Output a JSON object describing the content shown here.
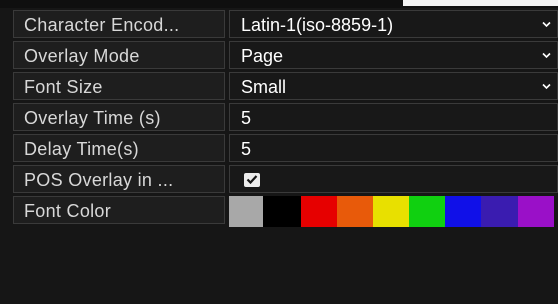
{
  "settings": {
    "rows": [
      {
        "label": "Character Encod...",
        "value": "Latin-1(iso-8859-1)"
      },
      {
        "label": "Overlay Mode",
        "value": "Page"
      },
      {
        "label": "Font Size",
        "value": "Small"
      },
      {
        "label": "Overlay Time (s)",
        "value": "5"
      },
      {
        "label": "Delay Time(s)",
        "value": "5"
      },
      {
        "label": "POS Overlay in ...",
        "checked": true
      },
      {
        "label": "Font Color"
      }
    ]
  },
  "icons": {
    "dropdown": "chevron-down-icon",
    "check": "checkmark-icon"
  },
  "font_colors": {
    "selected_index": 0,
    "swatches": [
      "#a8a8a8",
      "#000000",
      "#e60000",
      "#e85a0a",
      "#e8e000",
      "#10d010",
      "#1010e8",
      "#3a1cb0",
      "#9a10c8"
    ]
  },
  "colors": {
    "background": "#161616",
    "cell_border": "#3a3a3a",
    "label_text": "#d8d8d8",
    "value_text": "#ffffff"
  }
}
